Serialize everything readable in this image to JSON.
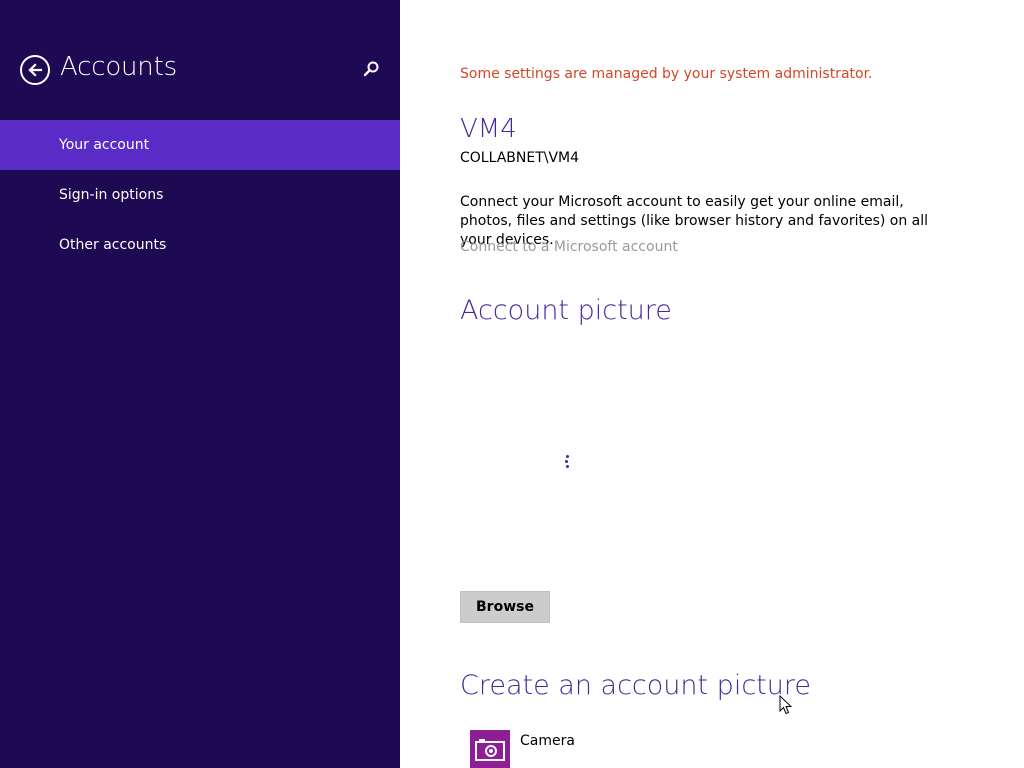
{
  "nav": {
    "title": "Accounts",
    "back_icon": "back-arrow-icon",
    "search_icon": "search-icon",
    "items": [
      {
        "label": "Your account",
        "selected": true
      },
      {
        "label": "Sign-in options",
        "selected": false
      },
      {
        "label": "Other accounts",
        "selected": false
      }
    ]
  },
  "main": {
    "admin_note": "Some settings are managed by your system administrator.",
    "user_name": "VM4",
    "user_domain": "COLLABNET\\VM4",
    "connect_description": "Connect your Microsoft account to easily get your online email, photos, files and settings (like browser history and favorites) on all your devices.",
    "connect_link": "Connect to a Microsoft account",
    "account_picture_title": "Account picture",
    "browse_label": "Browse",
    "create_picture_title": "Create an account picture",
    "camera_label": "Camera",
    "camera_icon": "camera-icon"
  },
  "colors": {
    "nav_bg": "#1e0a52",
    "nav_selected": "#5b2bc8",
    "accent": "#47299b",
    "warning": "#d24726",
    "camera_tile": "#8e1e96"
  }
}
